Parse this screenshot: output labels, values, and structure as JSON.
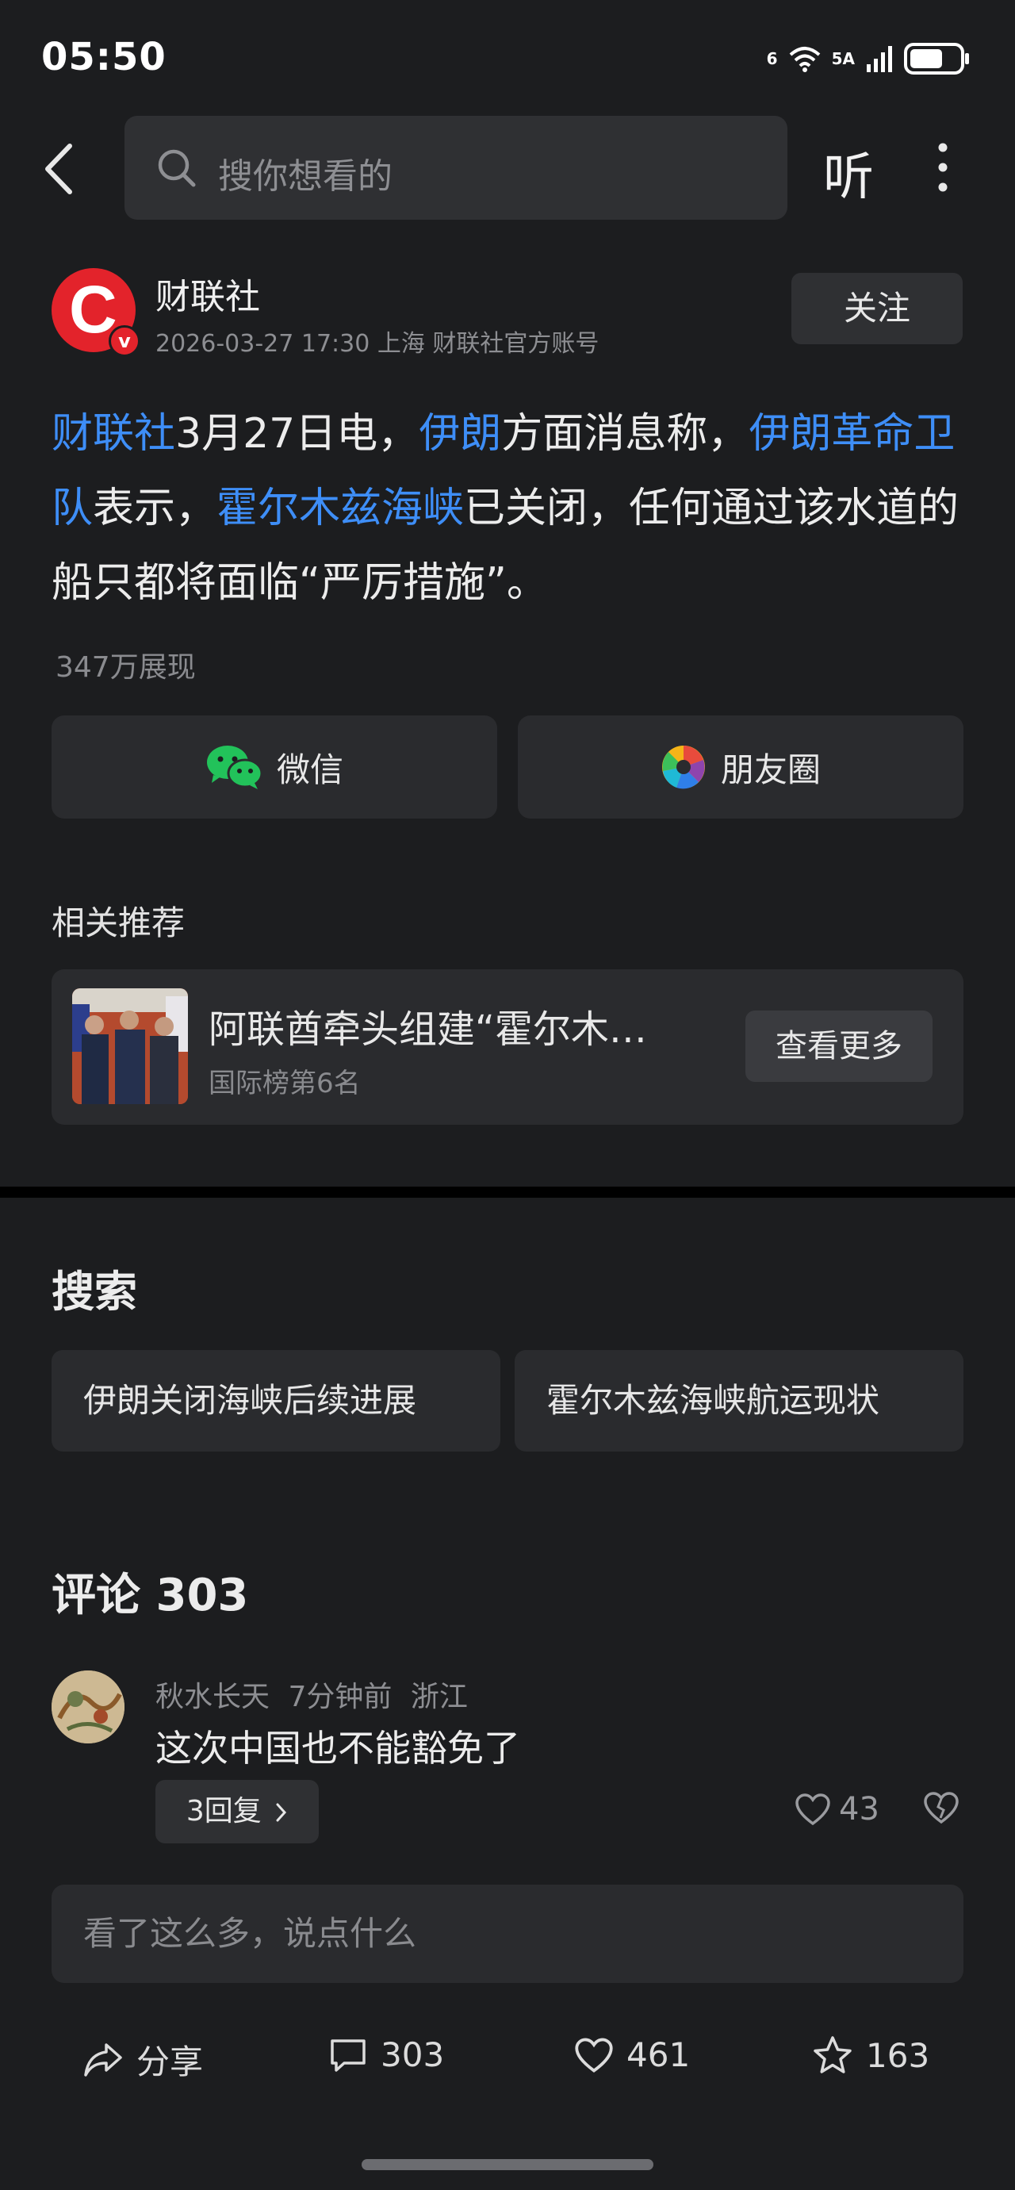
{
  "status_bar": {
    "time": "05:50",
    "wifi_label": "6",
    "network_label": "5A"
  },
  "search": {
    "placeholder": "搜你想看的"
  },
  "top_bar": {
    "listen_label": "听"
  },
  "author": {
    "name": "财联社",
    "meta": "2026-03-27 17:30 上海 财联社官方账号",
    "avatar_letter": "C",
    "verified_badge": "v",
    "follow_label": "关注"
  },
  "article": {
    "segments": [
      {
        "text": "财联社",
        "link": true
      },
      {
        "text": "3月27日电，",
        "link": false
      },
      {
        "text": "伊朗",
        "link": true
      },
      {
        "text": "方面消息称，",
        "link": false
      },
      {
        "text": "伊朗革命卫队",
        "link": true
      },
      {
        "text": "表示，",
        "link": false
      },
      {
        "text": "霍尔木兹海峡",
        "link": true
      },
      {
        "text": "已关闭，任何通过该水道的船只都将面临“严厉措施”。",
        "link": false
      }
    ],
    "views": "347万展现"
  },
  "share": {
    "wechat_label": "微信",
    "moments_label": "朋友圈"
  },
  "related": {
    "title": "相关推荐",
    "headline": "阿联酋牵头组建“霍尔木…",
    "rank": "国际榜第6名",
    "more_label": "查看更多"
  },
  "search_section": {
    "title": "搜索",
    "chips": [
      "伊朗关闭海峡后续进展",
      "霍尔木兹海峡航运现状"
    ]
  },
  "comments": {
    "title": "评论 303",
    "items": [
      {
        "user": "秋水长天",
        "time": "7分钟前",
        "location": "浙江",
        "text": "这次中国也不能豁免了",
        "replies": "3回复",
        "likes": "43"
      }
    ],
    "input_placeholder": "看了这么多，说点什么"
  },
  "actions": {
    "share_label": "分享",
    "comment_count": "303",
    "like_count": "461",
    "favorite_count": "163"
  },
  "colors": {
    "link": "#3e8ef7",
    "background": "#1c1d1f",
    "card": "#2a2b2e",
    "brand": "#e3232b"
  }
}
